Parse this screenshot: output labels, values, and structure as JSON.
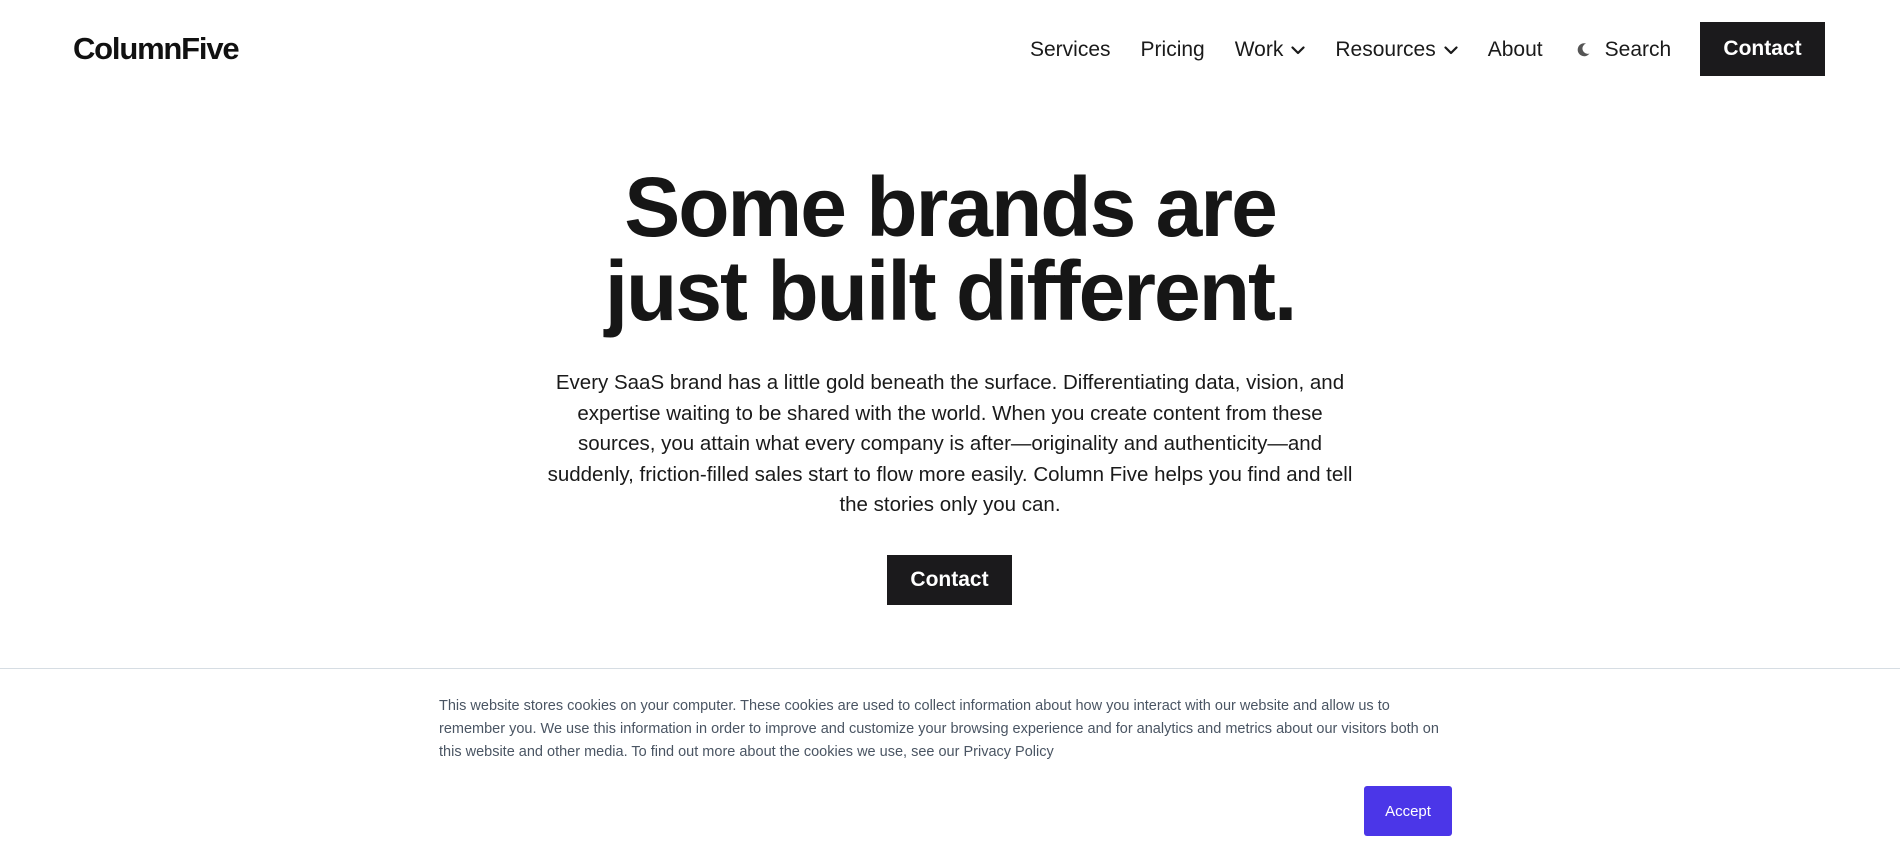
{
  "header": {
    "logo": "ColumnFive",
    "nav": [
      {
        "label": "Services",
        "has_dropdown": false
      },
      {
        "label": "Pricing",
        "has_dropdown": false
      },
      {
        "label": "Work",
        "has_dropdown": true
      },
      {
        "label": "Resources",
        "has_dropdown": true
      },
      {
        "label": "About",
        "has_dropdown": false
      }
    ],
    "search_label": "Search",
    "contact_label": "Contact"
  },
  "hero": {
    "title_line1": "Some brands are",
    "title_line2": "just built different.",
    "body": "Every SaaS brand has a little gold beneath the surface. Differentiating data, vision, and expertise waiting to be shared with the world. When you create content from these sources, you attain what every company is after—originality and authenticity—and suddenly, friction-filled sales start to flow more easily. Column Five helps you find and tell the stories only you can.",
    "contact_label": "Contact"
  },
  "cookie_banner": {
    "text": "This website stores cookies on your computer. These cookies are used to collect information about how you interact with our website and allow us to remember you. We use this information in order to improve and customize your browsing experience and for analytics and metrics about our visitors both on this website and other media. To find out more about the cookies we use, see our ",
    "link_label": "Privacy Policy",
    "accept_label": "Accept"
  },
  "colors": {
    "primary_dark": "#1b1a1c",
    "accept_button": "#4b36e8",
    "cookie_text": "#4a5563"
  },
  "icons": {
    "dropdown": "chevron-down-icon",
    "theme_toggle": "moon-icon"
  }
}
